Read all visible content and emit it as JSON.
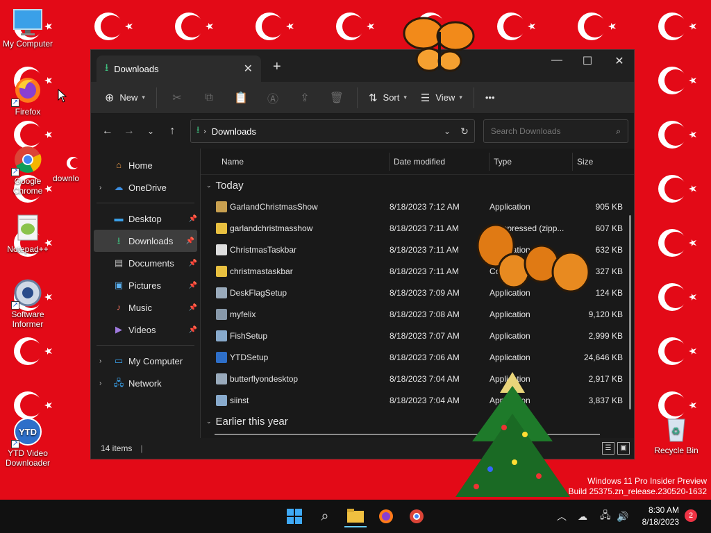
{
  "desktop": {
    "icons": [
      {
        "label": "My Computer"
      },
      {
        "label": "Firefox"
      },
      {
        "label": "Google Chrome"
      },
      {
        "label": "Notepad++"
      },
      {
        "label": "Software Informer"
      },
      {
        "label": "YTD Video Downloader"
      },
      {
        "label": "Recycle Bin"
      },
      {
        "label": "downlo"
      }
    ],
    "watermark_line1": "Windows 11 Pro Insider Preview",
    "watermark_line2": "Build 25375.zn_release.230520-1632"
  },
  "window": {
    "tab_title": "Downloads",
    "tab_close": "✕",
    "new_tab": "+",
    "minimize": "—",
    "maximize": "☐",
    "close": "✕",
    "commandbar": {
      "new_label": "New",
      "sort_label": "Sort",
      "view_label": "View",
      "more": "•••"
    },
    "address": {
      "crumb": "Downloads",
      "search_placeholder": "Search Downloads"
    },
    "nav": {
      "home": "Home",
      "onedrive": "OneDrive",
      "desktop": "Desktop",
      "downloads": "Downloads",
      "documents": "Documents",
      "pictures": "Pictures",
      "music": "Music",
      "videos": "Videos",
      "mycomputer": "My Computer",
      "network": "Network"
    },
    "columns": {
      "name": "Name",
      "date": "Date modified",
      "type": "Type",
      "size": "Size"
    },
    "groups": {
      "today": "Today",
      "earlier": "Earlier this year"
    },
    "files": [
      {
        "name": "GarlandChristmasShow",
        "date": "8/18/2023 7:12 AM",
        "type": "Application",
        "size": "905 KB"
      },
      {
        "name": "garlandchristmasshow",
        "date": "8/18/2023 7:11 AM",
        "type": "Compressed (zipp...",
        "size": "607 KB"
      },
      {
        "name": "ChristmasTaskbar",
        "date": "8/18/2023 7:11 AM",
        "type": "Application",
        "size": "632 KB"
      },
      {
        "name": "christmastaskbar",
        "date": "8/18/2023 7:11 AM",
        "type": "Compressed (zipp...",
        "size": "327 KB"
      },
      {
        "name": "DeskFlagSetup",
        "date": "8/18/2023 7:09 AM",
        "type": "Application",
        "size": "124 KB"
      },
      {
        "name": "myfelix",
        "date": "8/18/2023 7:08 AM",
        "type": "Application",
        "size": "9,120 KB"
      },
      {
        "name": "FishSetup",
        "date": "8/18/2023 7:07 AM",
        "type": "Application",
        "size": "2,999 KB"
      },
      {
        "name": "YTDSetup",
        "date": "8/18/2023 7:06 AM",
        "type": "Application",
        "size": "24,646 KB"
      },
      {
        "name": "butterflyondesktop",
        "date": "8/18/2023 7:04 AM",
        "type": "Application",
        "size": "2,917 KB"
      },
      {
        "name": "siinst",
        "date": "8/18/2023 7:04 AM",
        "type": "Application",
        "size": "3,837 KB"
      }
    ],
    "status": "14 items"
  },
  "taskbar": {
    "time": "8:30 AM",
    "date": "8/18/2023",
    "notifications": "2"
  }
}
